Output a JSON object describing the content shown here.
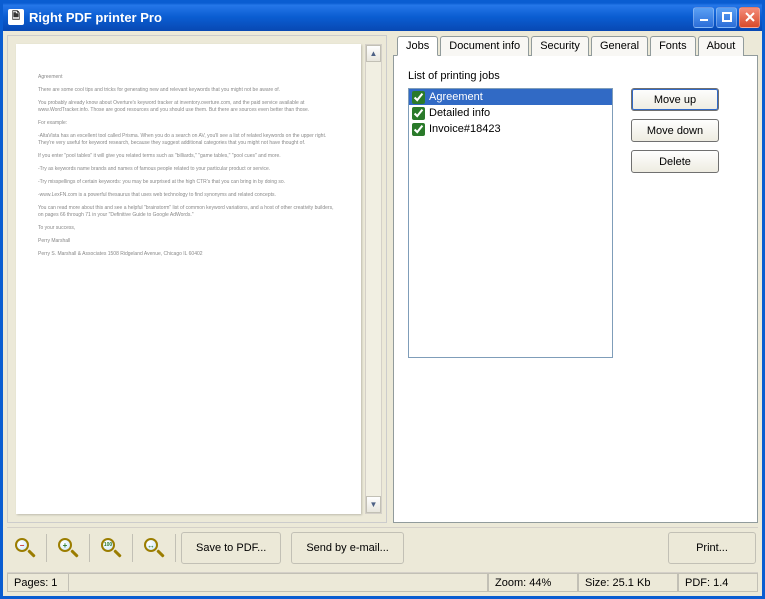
{
  "window_title": "Right PDF printer Pro",
  "tabs": [
    {
      "label": "Jobs"
    },
    {
      "label": "Document info"
    },
    {
      "label": "Security"
    },
    {
      "label": "General"
    },
    {
      "label": "Fonts"
    },
    {
      "label": "About"
    }
  ],
  "list_label": "List of printing jobs",
  "jobs": [
    {
      "label": "Agreement",
      "checked": true,
      "selected": true
    },
    {
      "label": "Detailed info",
      "checked": true,
      "selected": false
    },
    {
      "label": "Invoice#18423",
      "checked": true,
      "selected": false
    }
  ],
  "buttons": {
    "move_up": "Move up",
    "move_down": "Move down",
    "delete": "Delete",
    "save_pdf": "Save to PDF...",
    "send_email": "Send by e-mail...",
    "print": "Print..."
  },
  "status": {
    "pages": "Pages: 1",
    "zoom": "Zoom: 44%",
    "size": "Size: 25.1 Kb",
    "pdf": "PDF: 1.4"
  },
  "zoom_icons": {
    "minus": "−",
    "plus": "+",
    "hundred": "100",
    "fit": "↔"
  },
  "preview_text": [
    "Agreement",
    "There are some cool tips and tricks for generating new and relevant keywords that you might not be aware of.",
    "You probably already know about Overture's keyword tracker at inventory.overture.com, and the paid service available at www.WordTracker.info. Those are good resources and you should use them. But there are sources even better than those.",
    "For example:",
    "-AltaVista has an excellent tool called Prisma. When you do a search on AV, you'll see a list of related keywords on the upper right. They're very useful for keyword research, because they suggest additional categories that you might not have thought of.",
    "If you enter \"pool tables\" it will give you related terms such as \"billiards,\" \"game tables,\" \"pool cues\" and more.",
    "-Try as keywords name brands and names of famous people related to your particular product or service.",
    "-Try misspellings of certain keywords: you may be surprised at the high CTR's that you can bring in by doing so.",
    "-www.LexFN.com is a powerful thesaurus that uses web technology to find synonyms and related concepts.",
    "You can read more about this and see a helpful \"brainstorm\" list of common keyword variations, and a host of other creativity builders, on pages 66 through 71 in your \"Definitive Guide to Google AdWords.\"",
    "To your success,",
    "Perry Marshall",
    "Perry S. Marshall & Associates 1508 Ridgeland Avenue, Chicago IL 60402"
  ]
}
